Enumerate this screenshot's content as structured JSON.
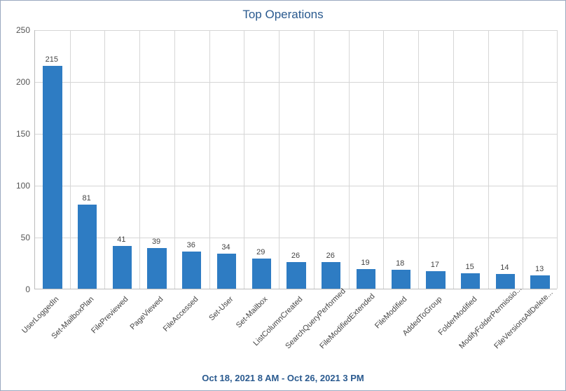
{
  "chart_data": {
    "type": "bar",
    "title": "Top Operations",
    "subtitle": "Oct 18, 2021 8 AM - Oct 26, 2021 3 PM",
    "ylim": [
      0,
      250
    ],
    "yticks": [
      0,
      50,
      100,
      150,
      200,
      250
    ],
    "categories": [
      "UserLoggedIn",
      "Set-MailboxPlan",
      "FilePreviewed",
      "PageViewed",
      "FileAccessed",
      "Set-User",
      "Set-Mailbox",
      "ListColumnCreated",
      "SearchQueryPerformed",
      "FileModifiedExtended",
      "FileModified",
      "AddedToGroup",
      "FolderModified",
      "ModifyFolderPermissio...",
      "FileVersionsAllDelete..."
    ],
    "values": [
      215,
      81,
      41,
      39,
      36,
      34,
      29,
      26,
      26,
      19,
      18,
      17,
      15,
      14,
      13
    ]
  }
}
